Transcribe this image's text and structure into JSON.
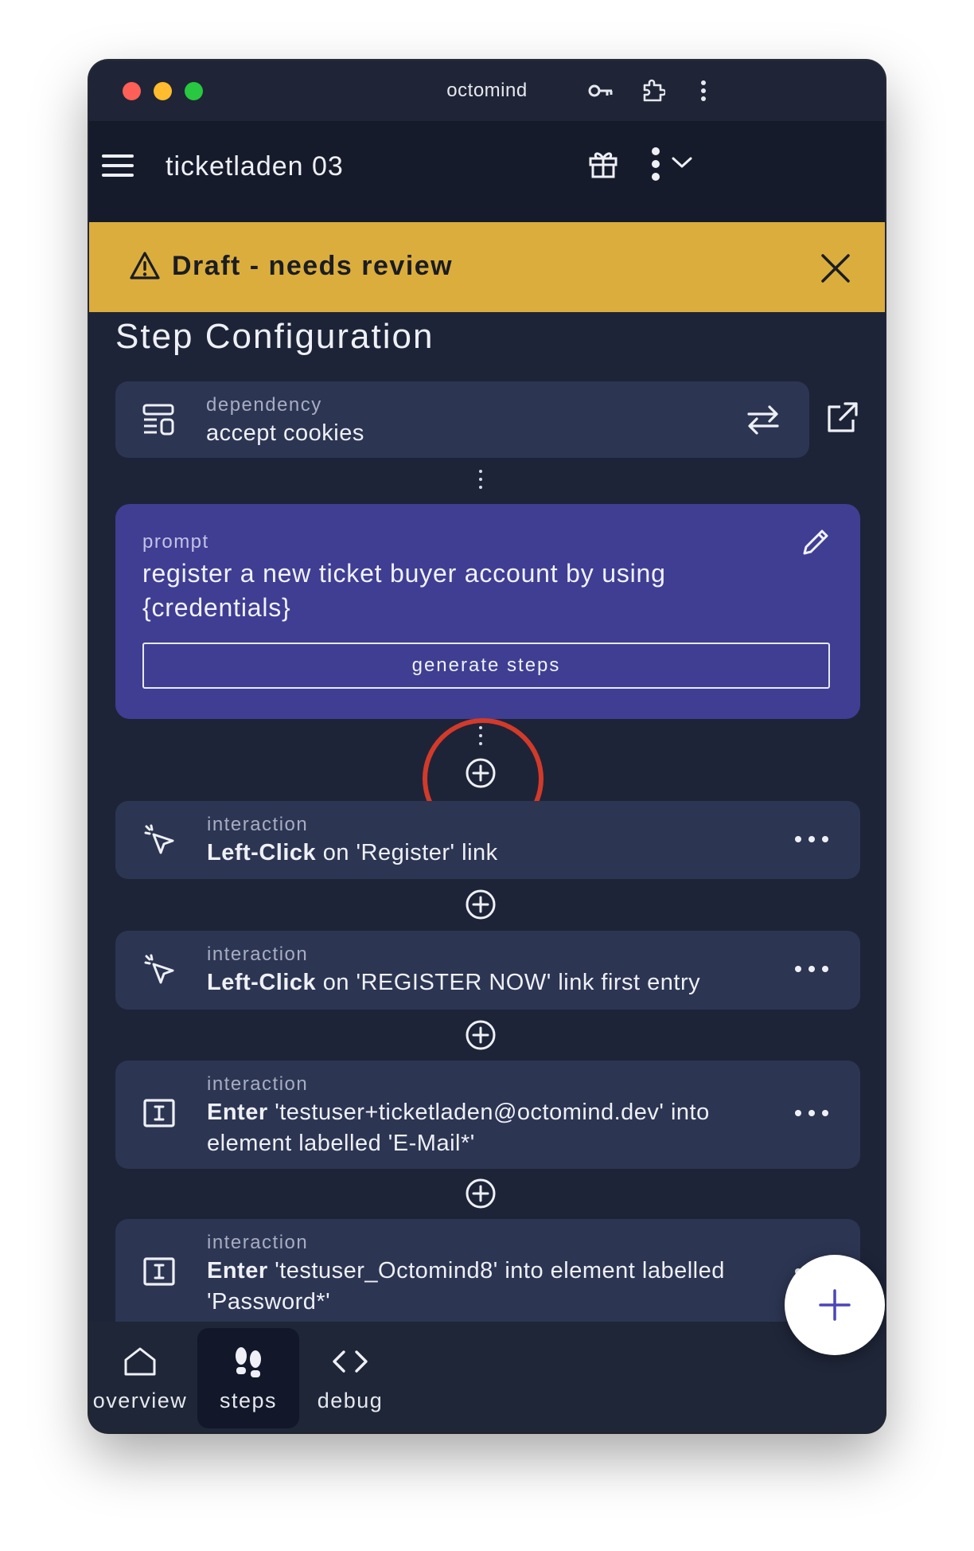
{
  "window": {
    "title": "octomind"
  },
  "appbar": {
    "title": "ticketladen 03"
  },
  "banner": {
    "text": "Draft - needs review"
  },
  "section": {
    "title": "Step Configuration"
  },
  "dependency": {
    "label": "dependency",
    "value": "accept cookies"
  },
  "prompt": {
    "label": "prompt",
    "text_line1": "register a new ticket buyer account by using",
    "text_line2": "{credentials}",
    "generate_label": "generate steps"
  },
  "steps": [
    {
      "label": "interaction",
      "action": "Left-Click",
      "line1": " on 'Register' link",
      "line2": "",
      "icon": "cursor-click-icon"
    },
    {
      "label": "interaction",
      "action": "Left-Click",
      "line1": " on 'REGISTER NOW' link first entry",
      "line2": "",
      "icon": "cursor-click-icon"
    },
    {
      "label": "interaction",
      "action": "Enter",
      "line1": " 'testuser+ticketladen@octomind.dev' into",
      "line2": "element labelled 'E-Mail*'",
      "icon": "text-input-icon"
    },
    {
      "label": "interaction",
      "action": "Enter",
      "line1": " 'testuser_Octomind8' into element labelled",
      "line2": "'Password*'",
      "icon": "text-input-icon"
    }
  ],
  "nav": [
    {
      "label": "overview",
      "icon": "home-icon",
      "active": false
    },
    {
      "label": "steps",
      "icon": "footsteps-icon",
      "active": true
    },
    {
      "label": "debug",
      "icon": "code-icon",
      "active": false
    }
  ],
  "colors": {
    "background": "#1d2438",
    "appbar": "#161b2c",
    "banner": "#dbad3c",
    "card": "#2c3552",
    "prompt_card": "#3f3e93",
    "annotation": "#d23a2a",
    "fab_plus": "#4a46b8"
  }
}
